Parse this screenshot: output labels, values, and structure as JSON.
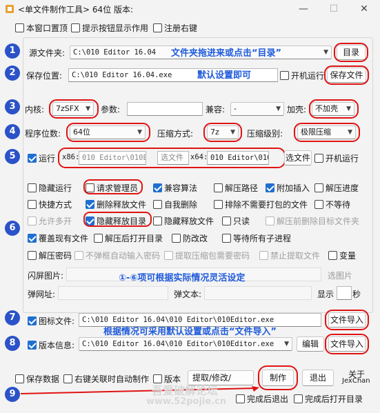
{
  "window": {
    "title": "<单文件制作工具> 64位 版本:",
    "minimize": "—",
    "maximize": "☐",
    "close": "✕"
  },
  "top_options": [
    {
      "label": "本窗口置顶",
      "checked": false
    },
    {
      "label": "提示按钮显示作用",
      "checked": false
    },
    {
      "label": "注册右键",
      "checked": false
    }
  ],
  "source": {
    "label": "源文件夹:",
    "value": "C:\\010 Editor 16.04",
    "hint": "文件夹拖进来或点击“目录”",
    "button": "目录"
  },
  "save": {
    "label": "保存位置:",
    "value": "C:\\010 Editor 16.04.exe",
    "hint": "默认设置即可",
    "autorun_label": "开机运行",
    "autorun_checked": false,
    "button": "保存文件"
  },
  "core": {
    "label": "内核:",
    "value": "7zSFX",
    "param_label": "参数:",
    "param_value": "",
    "compat_label": "兼容:",
    "compat_value": "-",
    "shell_label": "加壳:",
    "shell_value": "不加壳"
  },
  "bits": {
    "label": "程序位数:",
    "value": "64位",
    "method_label": "压缩方式:",
    "method_value": "7z",
    "level_label": "压缩级别:",
    "level_value": "极限压缩"
  },
  "run": {
    "label": "运行",
    "checked": true,
    "x86_label": "x86:",
    "x86_value": "010 Editor\\010E",
    "x86_placeholder": "选文件",
    "x64_label": "x64:",
    "x64_value": "010 Editor\\010",
    "button": "选文件",
    "autorun_label": "开机运行",
    "autorun_checked": false
  },
  "options": [
    {
      "label": "隐藏运行",
      "checked": false,
      "disabled": false
    },
    {
      "label": "请求管理员",
      "checked": false,
      "disabled": false
    },
    {
      "label": "兼容算法",
      "checked": true,
      "disabled": false
    },
    {
      "label": "解压路径",
      "checked": false,
      "disabled": false
    },
    {
      "label": "附加插入",
      "checked": true,
      "disabled": false
    },
    {
      "label": "解压进度",
      "checked": false,
      "disabled": false
    },
    {
      "label": "快捷方式",
      "checked": false,
      "disabled": false
    },
    {
      "label": "删除释放文件",
      "checked": true,
      "disabled": false
    },
    {
      "label": "自我删除",
      "checked": false,
      "disabled": false
    },
    {
      "label": "排除不需要打包的文件",
      "checked": false,
      "disabled": false
    },
    {
      "label": "不等待",
      "checked": false,
      "disabled": false
    },
    {
      "label": "允许多开",
      "checked": false,
      "disabled": true
    },
    {
      "label": "隐藏释放目录",
      "checked": true,
      "disabled": false
    },
    {
      "label": "隐藏释放文件",
      "checked": false,
      "disabled": false
    },
    {
      "label": "只读",
      "checked": false,
      "disabled": false
    },
    {
      "label": "解压前删除目标文件夹",
      "checked": false,
      "disabled": true
    },
    {
      "label": "覆盖现有文件",
      "checked": true,
      "disabled": false
    },
    {
      "label": "解压后打开目录",
      "checked": false,
      "disabled": false
    },
    {
      "label": "防改改",
      "checked": false,
      "disabled": false
    },
    {
      "label": "等待所有子进程",
      "checked": false,
      "disabled": false
    },
    {
      "label": "解压密码",
      "checked": false,
      "disabled": false
    },
    {
      "label": "不弹框自动输入密码",
      "checked": false,
      "disabled": true
    },
    {
      "label": "提取压缩包需要密码",
      "checked": false,
      "disabled": true
    },
    {
      "label": "禁止提取文件",
      "checked": false,
      "disabled": true
    },
    {
      "label": "变量",
      "checked": false,
      "disabled": false
    }
  ],
  "splash": {
    "label": "闪屏图片:",
    "button": "选图片"
  },
  "popup": {
    "url_label": "弹网址:",
    "text_label": "弹文本:",
    "show_label": "显示",
    "seconds_label": "秒"
  },
  "hint6": "①-⑥项可根据实际情况灵活设定",
  "icon": {
    "label": "图标文件:",
    "checked": true,
    "value": "C:\\010 Editor 16.04\\010 Editor\\010Editor.exe",
    "button": "文件导入"
  },
  "hint78": "根据情况可采用默认设置或点击“文件导入”",
  "version": {
    "label": "版本信息:",
    "checked": true,
    "value": "C:\\010 Editor 16.04\\010 Editor\\010Editor.exe",
    "edit_button": "编辑",
    "button": "文件导入"
  },
  "bottom": {
    "save_data": "保存数据",
    "save_data_checked": false,
    "right_click_auto": "右键关联时自动制作",
    "right_click_auto_checked": false,
    "version": "版本",
    "version_checked": false,
    "extract_button": "提取/修改/",
    "make_button": "制作",
    "exit_button": "退出",
    "about": "关于",
    "author": "JexChan",
    "exit_after": "完成后退出",
    "exit_after_checked": false,
    "open_after": "完成后打开目录",
    "open_after_checked": false
  },
  "watermark": {
    "line1": "吾爱破解论坛",
    "line2": "www.52pojie.cn"
  },
  "steps": [
    "1",
    "2",
    "3",
    "4",
    "5",
    "6",
    "7",
    "8",
    "9"
  ],
  "colors": {
    "accent": "#1f6fd0",
    "annotation": "#e01212",
    "step_badge": "#2b52c8",
    "hint": "#1f5adb"
  }
}
